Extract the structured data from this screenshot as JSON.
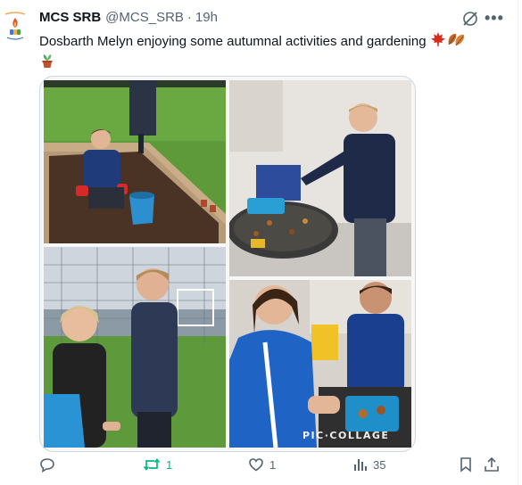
{
  "tweet": {
    "display_name": "MCS SRB",
    "handle": "@MCS_SRB",
    "separator": "·",
    "time": "19h",
    "text": "Dosbarth Melyn enjoying some autumnal activities and gardening",
    "emojis": [
      "maple-leaf",
      "fallen-leaf",
      "potted-plant"
    ]
  },
  "media": {
    "watermark": "PIC·COLLAGE",
    "photos": [
      "boy-digging-garden-bed",
      "boy-sorting-leaves-tray",
      "teacher-and-boy-on-field",
      "children-at-leaf-sensory-tray"
    ]
  },
  "actions": {
    "reply": {
      "icon": "reply-icon",
      "count": ""
    },
    "repost": {
      "icon": "repost-icon",
      "count": "1",
      "color": "#00ba7c"
    },
    "like": {
      "icon": "heart-icon",
      "count": "1"
    },
    "views": {
      "icon": "views-icon",
      "count": "35"
    },
    "bookmark": {
      "icon": "bookmark-icon"
    },
    "share": {
      "icon": "share-icon"
    }
  },
  "colors": {
    "secondary_text": "#536471",
    "repost_active": "#00ba7c",
    "border": "#cfd9de"
  }
}
